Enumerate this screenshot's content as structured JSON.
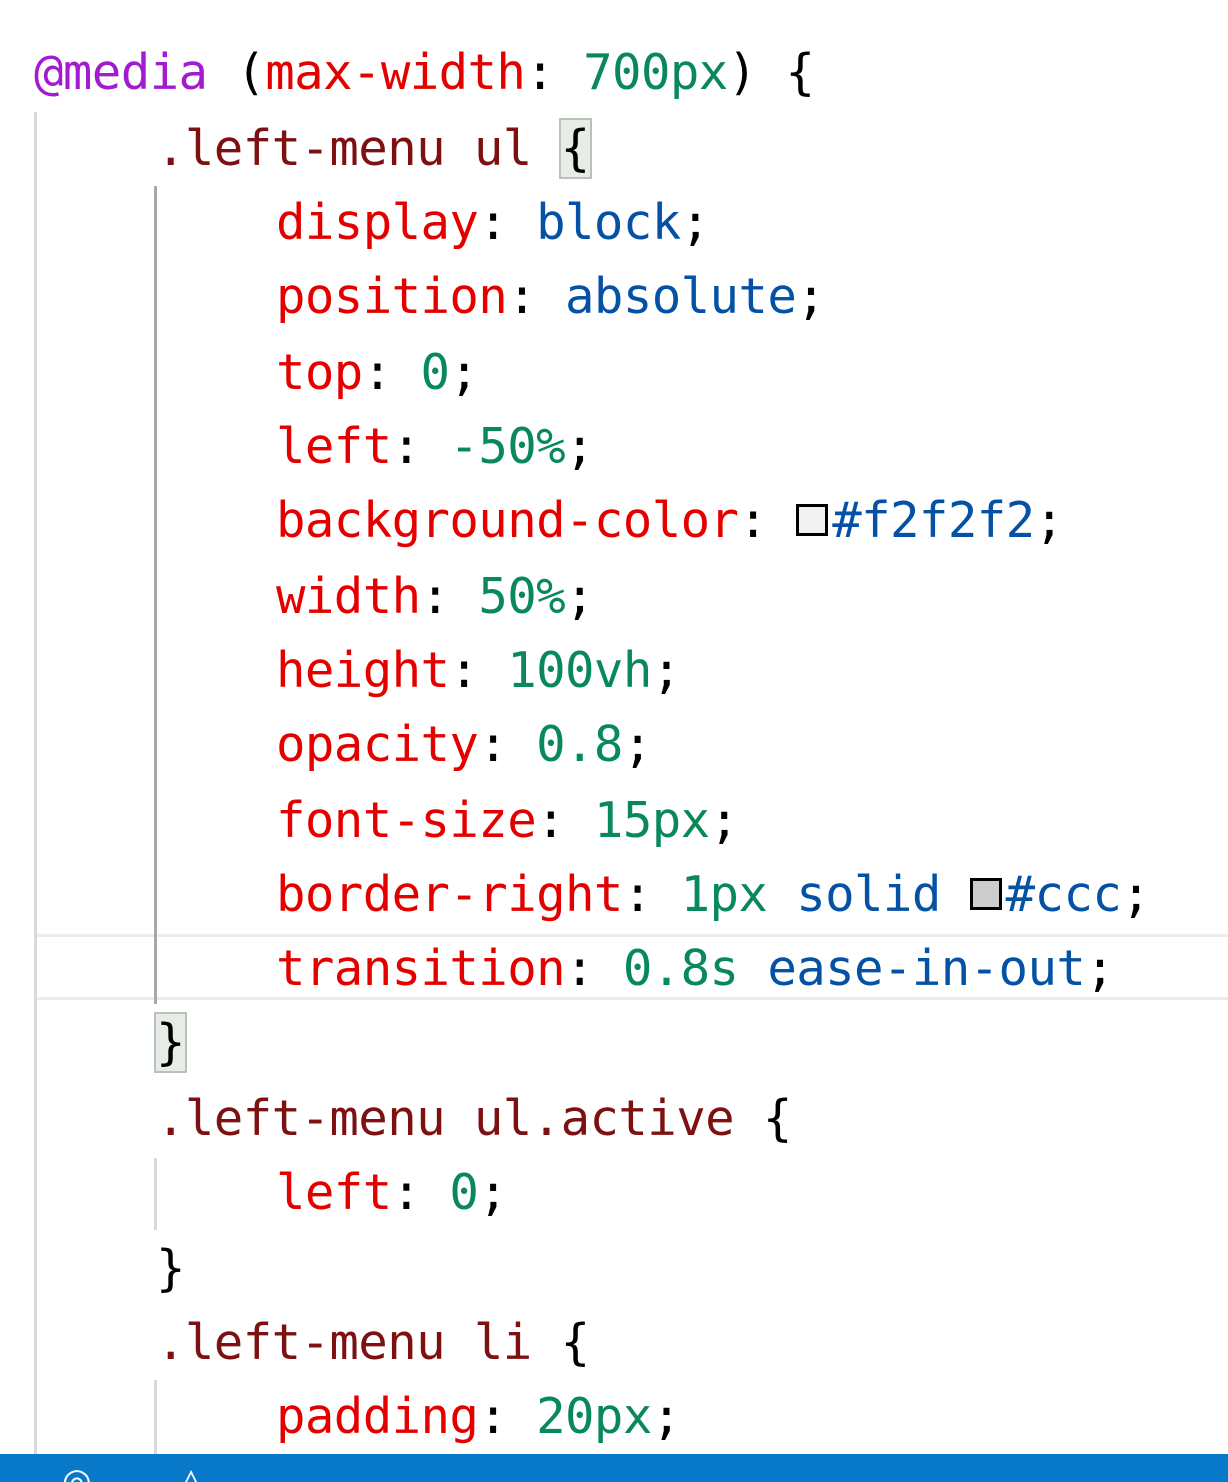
{
  "editor": {
    "lines": [
      {
        "at": "@media",
        "open_paren": " (",
        "feature": "max-width",
        "colon": ": ",
        "value": "700px",
        "close": ") {"
      },
      {
        "selector": ".left-menu ul",
        "space": " ",
        "brace": "{"
      },
      {
        "prop": "display",
        "colon": ": ",
        "value": "block",
        "semi": ";"
      },
      {
        "prop": "position",
        "colon": ": ",
        "value": "absolute",
        "semi": ";"
      },
      {
        "prop": "top",
        "colon": ": ",
        "value": "0",
        "semi": ";"
      },
      {
        "prop": "left",
        "colon": ": ",
        "value": "-50%",
        "semi": ";"
      },
      {
        "prop": "background-color",
        "colon": ": ",
        "value": "#f2f2f2",
        "semi": ";",
        "swatch": "#f2f2f2"
      },
      {
        "prop": "width",
        "colon": ": ",
        "value": "50%",
        "semi": ";"
      },
      {
        "prop": "height",
        "colon": ": ",
        "value": "100vh",
        "semi": ";"
      },
      {
        "prop": "opacity",
        "colon": ": ",
        "value": "0.8",
        "semi": ";"
      },
      {
        "prop": "font-size",
        "colon": ": ",
        "value": "15px",
        "semi": ";"
      },
      {
        "prop": "border-right",
        "colon": ": ",
        "value1": "1px",
        "value2": " solid ",
        "value3": "#ccc",
        "semi": ";",
        "swatch": "#cccccc"
      },
      {
        "prop": "transition",
        "colon": ": ",
        "value1": "0.8s",
        "value2": " ease-in-out",
        "semi": ";"
      },
      {
        "brace": "}"
      },
      {
        "selector": ".left-menu ul.active",
        "space": " ",
        "brace": "{"
      },
      {
        "prop": "left",
        "colon": ": ",
        "value": "0",
        "semi": ";"
      },
      {
        "brace": "}"
      },
      {
        "selector": ".left-menu li",
        "space": " ",
        "brace": "{"
      },
      {
        "prop": "padding",
        "colon": ": ",
        "value": "20px",
        "semi": ";"
      }
    ]
  },
  "statusbar": {
    "color": "#0878c9",
    "icons": [
      "remote-icon",
      "warning-icon"
    ]
  },
  "colors": {
    "at_rule": "#a21bd0",
    "selector": "#7d1010",
    "property": "#e50000",
    "number": "#09885a",
    "keyword": "#0451a5"
  }
}
